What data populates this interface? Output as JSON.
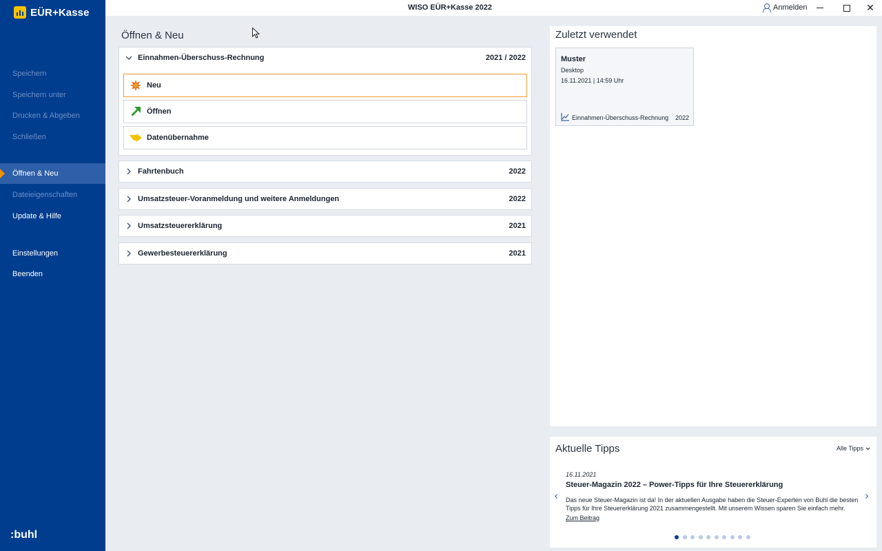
{
  "app": {
    "logo_text": "EÜR+Kasse",
    "window_title": "WISO EÜR+Kasse 2022",
    "login_label": "Anmelden",
    "brand": "buhl",
    "close_glyph": "✕"
  },
  "sidebar": {
    "items": [
      {
        "label": "Speichern",
        "state": "disabled"
      },
      {
        "label": "Speichern unter",
        "state": "disabled"
      },
      {
        "label": "Drucken & Abgeben",
        "state": "disabled"
      },
      {
        "label": "Schließen",
        "state": "disabled"
      },
      {
        "label": "Öffnen & Neu",
        "state": "active"
      },
      {
        "label": "Dateieigenschaften",
        "state": "disabled"
      },
      {
        "label": "Update & Hilfe",
        "state": "enabled"
      },
      {
        "label": "Einstellungen",
        "state": "enabled"
      },
      {
        "label": "Beenden",
        "state": "enabled"
      }
    ]
  },
  "main": {
    "title": "Öffnen & Neu",
    "sections": [
      {
        "label": "Einnahmen-Überschuss-Rechnung",
        "year": "2021 / 2022",
        "expanded": true
      },
      {
        "label": "Fahrtenbuch",
        "year": "2022",
        "expanded": false
      },
      {
        "label": "Umsatzsteuer-Voranmeldung und weitere Anmeldungen",
        "year": "2022",
        "expanded": false
      },
      {
        "label": "Umsatzsteuererklärung",
        "year": "2021",
        "expanded": false
      },
      {
        "label": "Gewerbesteuererklärung",
        "year": "2021",
        "expanded": false
      }
    ],
    "actions": [
      {
        "label": "Neu",
        "icon": "starburst-icon"
      },
      {
        "label": "Öffnen",
        "icon": "green-arrow-icon"
      },
      {
        "label": "Datenübernahme",
        "icon": "import-arrow-icon"
      }
    ]
  },
  "recent": {
    "title": "Zuletzt verwendet",
    "card": {
      "name": "Muster",
      "location": "Desktop",
      "datetime": "16.11.2021 | 14:59 Uhr",
      "type": "Einnahmen-Überschuss-Rechnung",
      "year": "2022"
    }
  },
  "tips": {
    "title": "Aktuelle Tipps",
    "all_label": "Alle Tipps",
    "date": "16.11.2021",
    "headline": "Steuer-Magazin 2022 – Power-Tipps für Ihre Steuererklärung",
    "text": "Das neue Steuer-Magazin ist da! In der aktuellen Ausgabe haben die Steuer-Experten von Buhl die besten Tipps für Ihre Steuererklärung 2021 zusammengestellt. Mit unserem Wissen sparen Sie einfach mehr.",
    "link": "Zum Beitrag",
    "prev_glyph": "‹",
    "next_glyph": "›",
    "dot_count": 10,
    "active_dot": 0
  },
  "colors": {
    "sidebar": "#003d8f",
    "active_nav": "#2f5fa8",
    "accent": "#f39200",
    "highlight_border": "#f39a33"
  }
}
